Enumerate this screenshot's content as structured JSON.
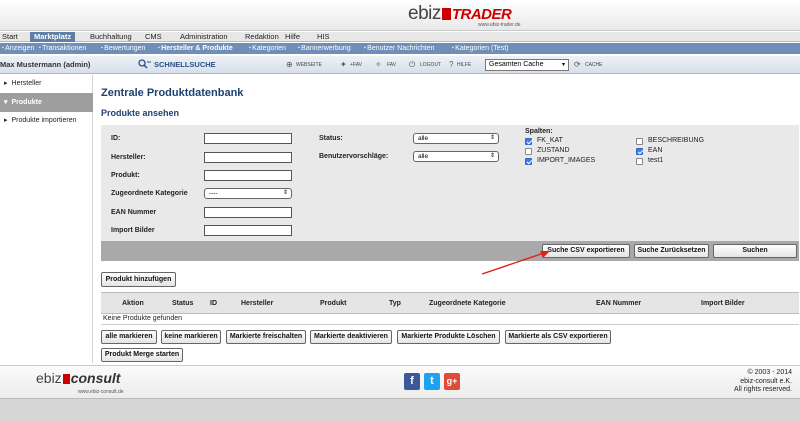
{
  "brand": {
    "logo_left": "ebiz",
    "logo_right": "TRADER",
    "url": "www.ebiz-trader.de"
  },
  "menu": {
    "items": [
      "Start",
      "Marktplatz",
      "Buchhaltung",
      "CMS",
      "Administration",
      "Redaktion",
      "Hilfe",
      "HIS"
    ],
    "active": "Marktplatz"
  },
  "submenu": {
    "items": [
      "Anzeigen",
      "Transaktionen",
      "Bewertungen",
      "Hersteller & Produkte",
      "Kategorien",
      "Bannerwerbung",
      "Benutzer Nachrichten",
      "Kategorien (Test)"
    ]
  },
  "userbar": {
    "user": "Max Mustermann (admin)",
    "quicksearch": "SCHNELLSUCHE",
    "webseite": "WEBSEITE",
    "fav_add": "+FAV",
    "fav": "FAV",
    "logout": "LOGOUT",
    "hilfe": "HILFE",
    "cache_select": "Gesamten Cache",
    "cache": "CACHE"
  },
  "sidebar": {
    "hersteller": "Hersteller",
    "produkte": "Produkte",
    "import": "Produkte importieren"
  },
  "page": {
    "title": "Zentrale Produktdatenbank",
    "subtitle": "Produkte ansehen"
  },
  "form": {
    "labels": {
      "id": "ID:",
      "hersteller": "Hersteller:",
      "produkt": "Produkt:",
      "kategorie": "Zugeordnete Kategorie",
      "ean": "EAN Nummer",
      "import": "Import Bilder",
      "status": "Status:",
      "vorschlaege": "Benutzervorschläge:",
      "spalten": "Spalten:"
    },
    "values": {
      "id": "",
      "hersteller": "",
      "produkt": "",
      "ean": "",
      "import": ""
    },
    "kategorie_select": "----",
    "status_select": "alle",
    "vorschlaege_select": "alle",
    "columns": [
      {
        "label": "FK_KAT",
        "checked": true
      },
      {
        "label": "ZUSTAND",
        "checked": false
      },
      {
        "label": "IMPORT_IMAGES",
        "checked": true
      },
      {
        "label": "BESCHREIBUNG",
        "checked": false
      },
      {
        "label": "EAN",
        "checked": true
      },
      {
        "label": "test1",
        "checked": false
      }
    ]
  },
  "actions": {
    "export": "Suche CSV exportieren",
    "reset": "Suche Zurücksetzen",
    "search": "Suchen"
  },
  "add_product": "Produkt hinzufügen",
  "table": {
    "headers": [
      "Aktion",
      "Status",
      "ID",
      "Hersteller",
      "Produkt",
      "Typ",
      "Zugeordnete Kategorie",
      "EAN Nummer",
      "Import Bilder"
    ],
    "empty": "Keine Produkte gefunden"
  },
  "bulk": {
    "all": "alle markieren",
    "none": "keine markieren",
    "activate": "Markierte freischalten",
    "deactivate": "Markierte deaktivieren",
    "delete": "Markierte Produkte Löschen",
    "csv": "Markierte als CSV exportieren",
    "merge": "Produkt Merge starten"
  },
  "footer": {
    "logo_left": "ebiz",
    "logo_right": "consult",
    "url": "www.ebiz-consult.de",
    "copy1": "© 2003 - 2014",
    "copy2": "ebiz-consult e.K.",
    "copy3": "All rights reserved.",
    "fb": "f",
    "tw": "t",
    "gp": "g+"
  },
  "colors": {
    "accent": "#1f3f73",
    "menu_blue": "#6f8fb8",
    "arrow": "#e0201b",
    "facebook": "#3b5998",
    "twitter": "#1da1f2",
    "google": "#dd4b39"
  }
}
